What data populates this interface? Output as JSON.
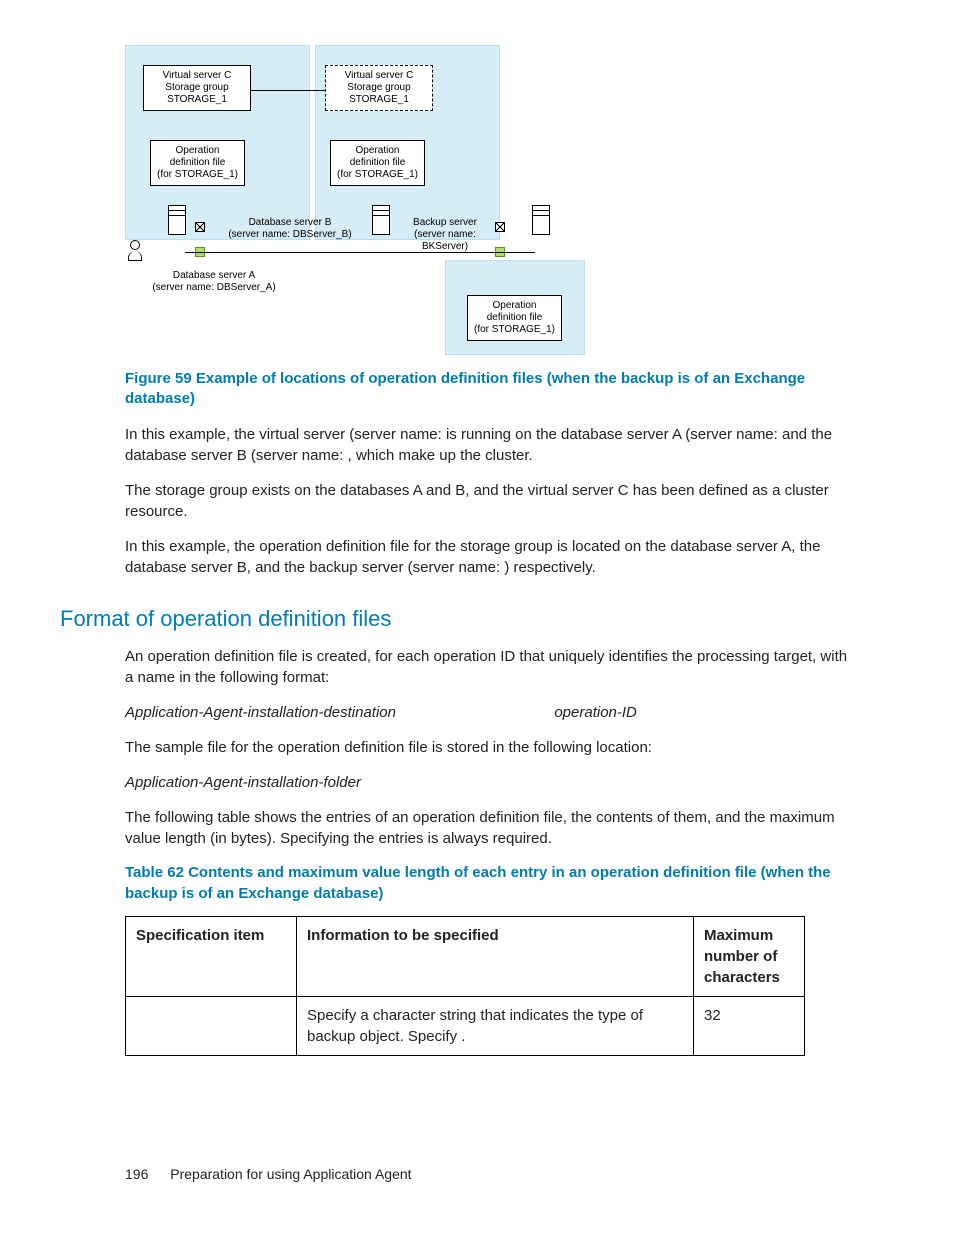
{
  "diagram": {
    "vsc1_l1": "Virtual server C",
    "vsc1_l2": "Storage group",
    "vsc1_l3": "STORAGE_1",
    "vsc2_l1": "Virtual server C",
    "vsc2_l2": "Storage group",
    "vsc2_l3": "STORAGE_1",
    "odf1_l1": "Operation",
    "odf1_l2": "definition file",
    "odf1_l3": "(for STORAGE_1)",
    "odf2_l1": "Operation",
    "odf2_l2": "definition file",
    "odf2_l3": "(for STORAGE_1)",
    "odf3_l1": "Operation",
    "odf3_l2": "definition file",
    "odf3_l3": "(for STORAGE_1)",
    "dbB_l1": "Database server B",
    "dbB_l2": "(server name: DBServer_B)",
    "bk_l1": "Backup server",
    "bk_l2": "(server name: BKServer)",
    "dbA_l1": "Database server A",
    "dbA_l2": "(server name: DBServer_A)"
  },
  "figcap": "Figure 59 Example of locations of operation definition files (when the backup is of an Exchange database)",
  "para1": {
    "t1": "In this example, the virtual server (server name: ",
    "t2": " is running on the database server A (server name: ",
    "t3": " and the database server B (server name: ",
    "t4": ", which make up the cluster."
  },
  "para2": {
    "t1": "The storage group ",
    "t2": " exists on the databases A and B, and the virtual server C has been defined as a cluster resource."
  },
  "para3": {
    "t1": "In this example, the operation definition file for the storage group ",
    "t2": " is located on the database server A, the database server B, and the backup server (server name: ",
    "t3": ") respectively."
  },
  "section": "Format of operation definition files",
  "para4": "An operation definition file is created, for each operation ID that uniquely identifies the processing target, with a name in the following format:",
  "para5a": "Application-Agent-installation-destination",
  "para5b": "operation-ID",
  "para6": "The sample file for the operation definition file is stored in the following location:",
  "para7": "Application-Agent-installation-folder",
  "para8": "The following table shows the entries of an operation definition file, the contents of them, and the maximum value length (in bytes). Specifying the entries is always required.",
  "tabcap": "Table 62 Contents and maximum value length of each entry in an operation definition file (when the backup is of an Exchange database)",
  "table": {
    "h1": "Specification item",
    "h2": "Information to be specified",
    "h3": "Maximum number of characters",
    "r1c1": "",
    "r1c2a": "Specify a character string that indicates the type of backup object. Specify ",
    "r1c2b": ".",
    "r1c3": "32"
  },
  "footer": {
    "page": "196",
    "title": "Preparation for using Application Agent"
  }
}
